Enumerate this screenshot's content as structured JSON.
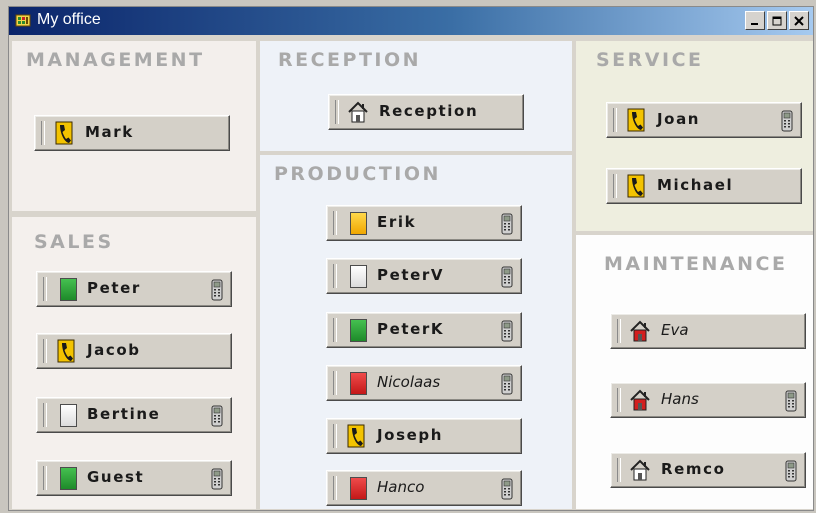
{
  "window": {
    "title": "My office",
    "controls": {
      "minimize": "_",
      "maximize": "□",
      "close": "×"
    }
  },
  "colors": {
    "title_bar_start": "#0a246a",
    "title_bar_end": "#a6caf0",
    "panel_title": "#a9a9a9",
    "status_green": "#2aa83a",
    "status_yellow": "#f5b800",
    "status_red": "#d42323",
    "status_white": "#f2f2f2"
  },
  "panels": {
    "management": {
      "title": "MANAGEMENT",
      "users": [
        {
          "name": "Mark",
          "status": "phone",
          "italic": false,
          "mobile": false
        }
      ]
    },
    "sales": {
      "title": "SALES",
      "users": [
        {
          "name": "Peter",
          "status": "green",
          "italic": false,
          "mobile": true
        },
        {
          "name": "Jacob",
          "status": "phone",
          "italic": false,
          "mobile": false
        },
        {
          "name": "Bertine",
          "status": "white",
          "italic": false,
          "mobile": true
        },
        {
          "name": "Guest",
          "status": "green",
          "italic": false,
          "mobile": true
        }
      ]
    },
    "reception": {
      "title": "RECEPTION",
      "users": [
        {
          "name": "Reception",
          "status": "house",
          "italic": false,
          "mobile": false
        }
      ]
    },
    "production": {
      "title": "PRODUCTION",
      "users": [
        {
          "name": "Erik",
          "status": "yellow",
          "italic": false,
          "mobile": true
        },
        {
          "name": "PeterV",
          "status": "white",
          "italic": false,
          "mobile": true
        },
        {
          "name": "PeterK",
          "status": "green",
          "italic": false,
          "mobile": true
        },
        {
          "name": "Nicolaas",
          "status": "red",
          "italic": true,
          "mobile": true
        },
        {
          "name": "Joseph",
          "status": "phone",
          "italic": false,
          "mobile": false
        },
        {
          "name": "Hanco",
          "status": "red",
          "italic": true,
          "mobile": true
        }
      ]
    },
    "service": {
      "title": "SERVICE",
      "users": [
        {
          "name": "Joan",
          "status": "phone",
          "italic": false,
          "mobile": true
        },
        {
          "name": "Michael",
          "status": "phone",
          "italic": false,
          "mobile": false
        }
      ]
    },
    "maintenance": {
      "title": "MAINTENANCE",
      "users": [
        {
          "name": "Eva",
          "status": "house-red",
          "italic": true,
          "mobile": false
        },
        {
          "name": "Hans",
          "status": "house-red",
          "italic": true,
          "mobile": true
        },
        {
          "name": "Remco",
          "status": "house",
          "italic": false,
          "mobile": true
        }
      ]
    }
  }
}
